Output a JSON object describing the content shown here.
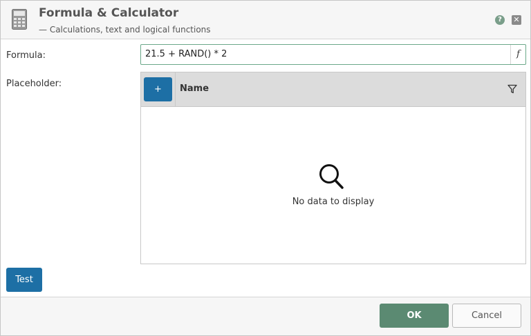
{
  "header": {
    "title": "Formula & Calculator",
    "subtitle": "— Calculations, text and logical functions",
    "app_icon": "calculator-icon",
    "help_icon": "help-icon",
    "help_glyph": "?",
    "close_icon": "close-icon",
    "close_glyph": "✕"
  },
  "form": {
    "formula_label": "Formula:",
    "formula_value": "21.5 + RAND() * 2",
    "fx_glyph": "f",
    "placeholder_label": "Placeholder:"
  },
  "grid": {
    "add_glyph": "+",
    "columns": [
      "Name"
    ],
    "filter_icon": "filter-icon",
    "empty_icon": "search-icon",
    "empty_text": "No data to display"
  },
  "actions": {
    "test_label": "Test",
    "ok_label": "OK",
    "cancel_label": "Cancel"
  },
  "colors": {
    "accent_blue": "#1d6fa5",
    "ok_green": "#5b8a72",
    "focus_border": "#6aa889"
  }
}
